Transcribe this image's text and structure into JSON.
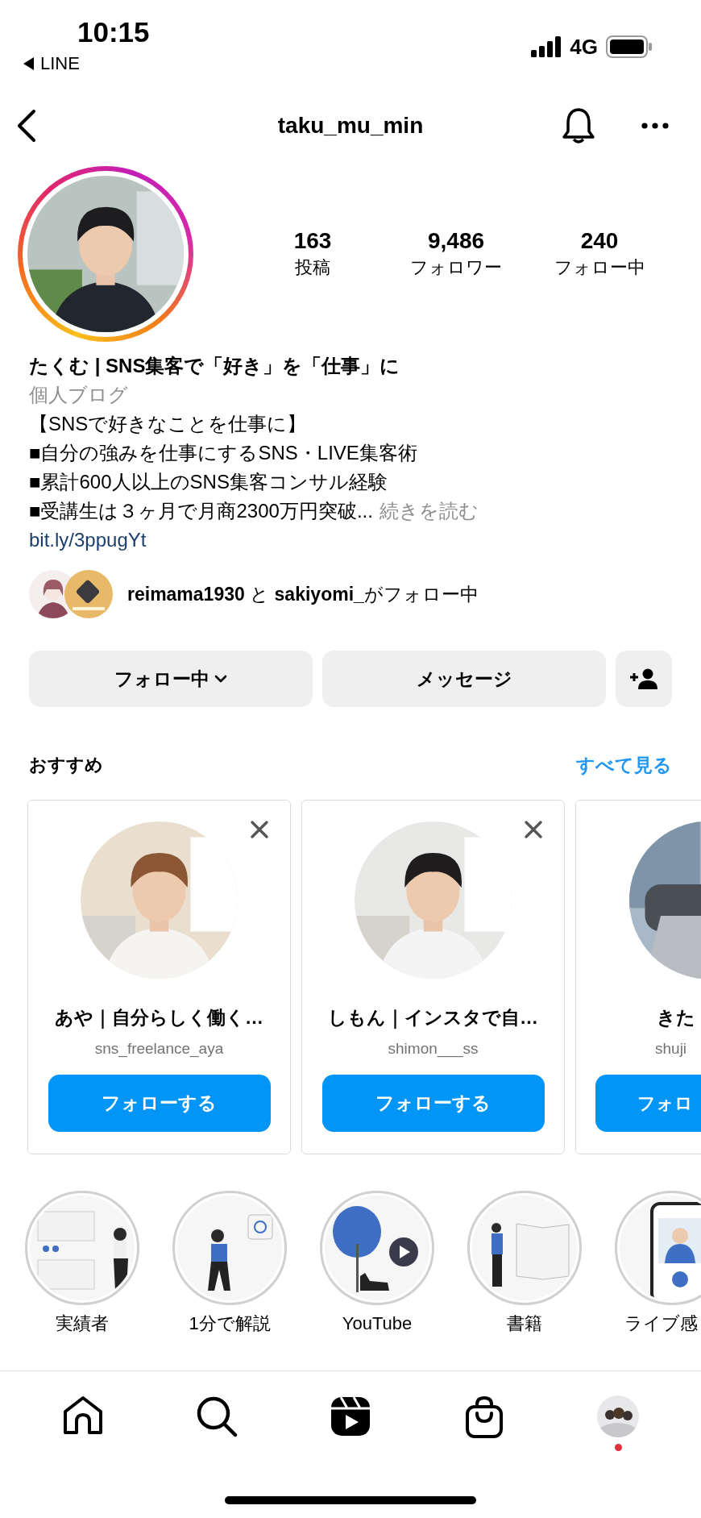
{
  "status_bar": {
    "time": "10:15",
    "back_app": "LINE",
    "network": "4G"
  },
  "header": {
    "username": "taku_mu_min"
  },
  "stats": [
    {
      "value": "163",
      "label": "投稿"
    },
    {
      "value": "9,486",
      "label": "フォロワー"
    },
    {
      "value": "240",
      "label": "フォロー中"
    }
  ],
  "bio": {
    "name": "たくむ | SNS集客で「好き」を「仕事」に",
    "category": "個人ブログ",
    "lines": [
      "【SNSで好きなことを仕事に】",
      "■自分の強みを仕事にするSNS・LIVE集客術",
      "■累計600人以上のSNS集客コンサル経験",
      "■受講生は３ヶ月で月商2300万円突破..."
    ],
    "more": "続きを読む",
    "link": "bit.ly/3ppugYt"
  },
  "followed_by": {
    "text": "**reimama1930** と **sakiyomi_**がフォロー中"
  },
  "actions": {
    "following": "フォロー中",
    "message": "メッセージ"
  },
  "suggestions": {
    "title": "おすすめ",
    "see_all": "すべて見る",
    "cards": [
      {
        "name": "あや｜自分らしく働く…",
        "username": "sns_freelance_aya",
        "button": "フォローする"
      },
      {
        "name": "しもん｜インスタで自…",
        "username": "shimon___ss",
        "button": "フォローする"
      },
      {
        "name": "きた",
        "username": "shuji",
        "button": "フォロ"
      }
    ]
  },
  "highlights": [
    {
      "label": "実績者"
    },
    {
      "label": "1分で解説"
    },
    {
      "label": "YouTube"
    },
    {
      "label": "書籍"
    },
    {
      "label": "ライブ感"
    }
  ],
  "nav": {
    "profile_notification": true
  }
}
